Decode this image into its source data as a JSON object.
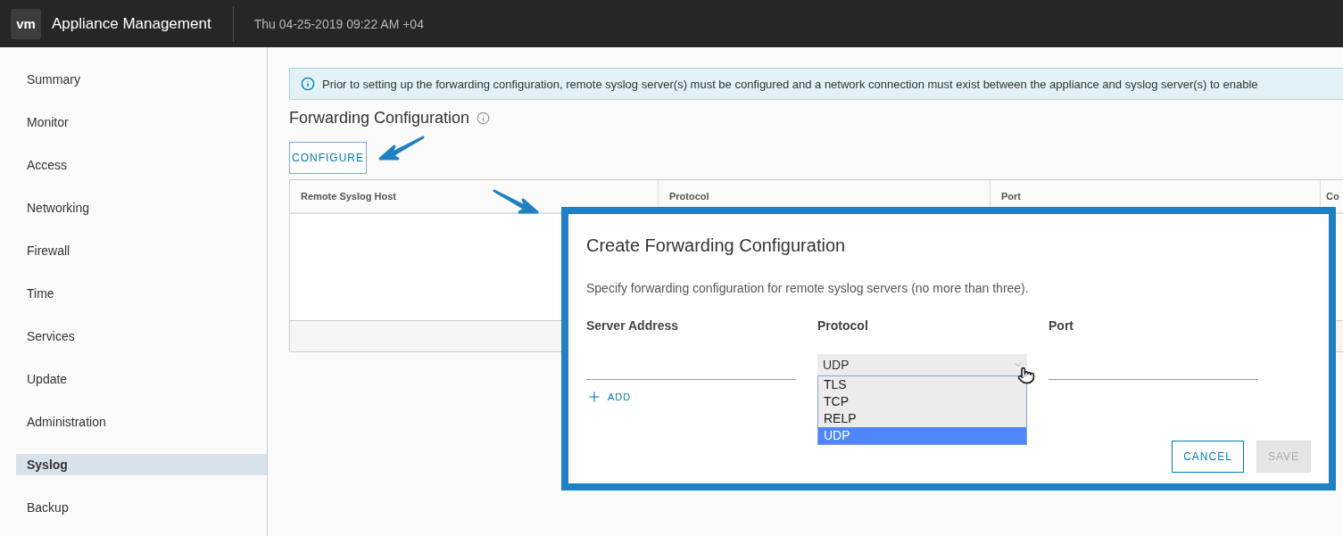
{
  "header": {
    "logo": "vm",
    "title": "Appliance Management",
    "datetime": "Thu 04-25-2019 09:22 AM +04"
  },
  "sidebar": {
    "items": [
      {
        "label": "Summary",
        "selected": false
      },
      {
        "label": "Monitor",
        "selected": false
      },
      {
        "label": "Access",
        "selected": false
      },
      {
        "label": "Networking",
        "selected": false
      },
      {
        "label": "Firewall",
        "selected": false
      },
      {
        "label": "Time",
        "selected": false
      },
      {
        "label": "Services",
        "selected": false
      },
      {
        "label": "Update",
        "selected": false
      },
      {
        "label": "Administration",
        "selected": false
      },
      {
        "label": "Syslog",
        "selected": true
      },
      {
        "label": "Backup",
        "selected": false
      }
    ]
  },
  "alert": {
    "text": "Prior to setting up the forwarding configuration, remote syslog server(s) must be configured and a network connection must exist between the appliance and syslog server(s) to enable"
  },
  "section": {
    "title": "Forwarding Configuration",
    "configure_button": "CONFIGURE"
  },
  "table": {
    "columns": [
      "Remote Syslog Host",
      "Protocol",
      "Port",
      "Co"
    ]
  },
  "dialog": {
    "title": "Create Forwarding Configuration",
    "description": "Specify forwarding configuration for remote syslog servers (no more than three).",
    "fields": [
      {
        "kind": "text",
        "label": "Server Address"
      },
      {
        "kind": "select",
        "label": "Protocol",
        "value": "UDP",
        "expanded": true,
        "options": [
          {
            "label": "TLS",
            "selected": false
          },
          {
            "label": "TCP",
            "selected": false
          },
          {
            "label": "RELP",
            "selected": false
          },
          {
            "label": "UDP",
            "selected": true
          }
        ]
      },
      {
        "kind": "text",
        "label": "Port"
      }
    ],
    "add_button": "ADD",
    "buttons": [
      {
        "label": "CANCEL",
        "disabled": false
      },
      {
        "label": "SAVE",
        "disabled": true
      }
    ]
  }
}
